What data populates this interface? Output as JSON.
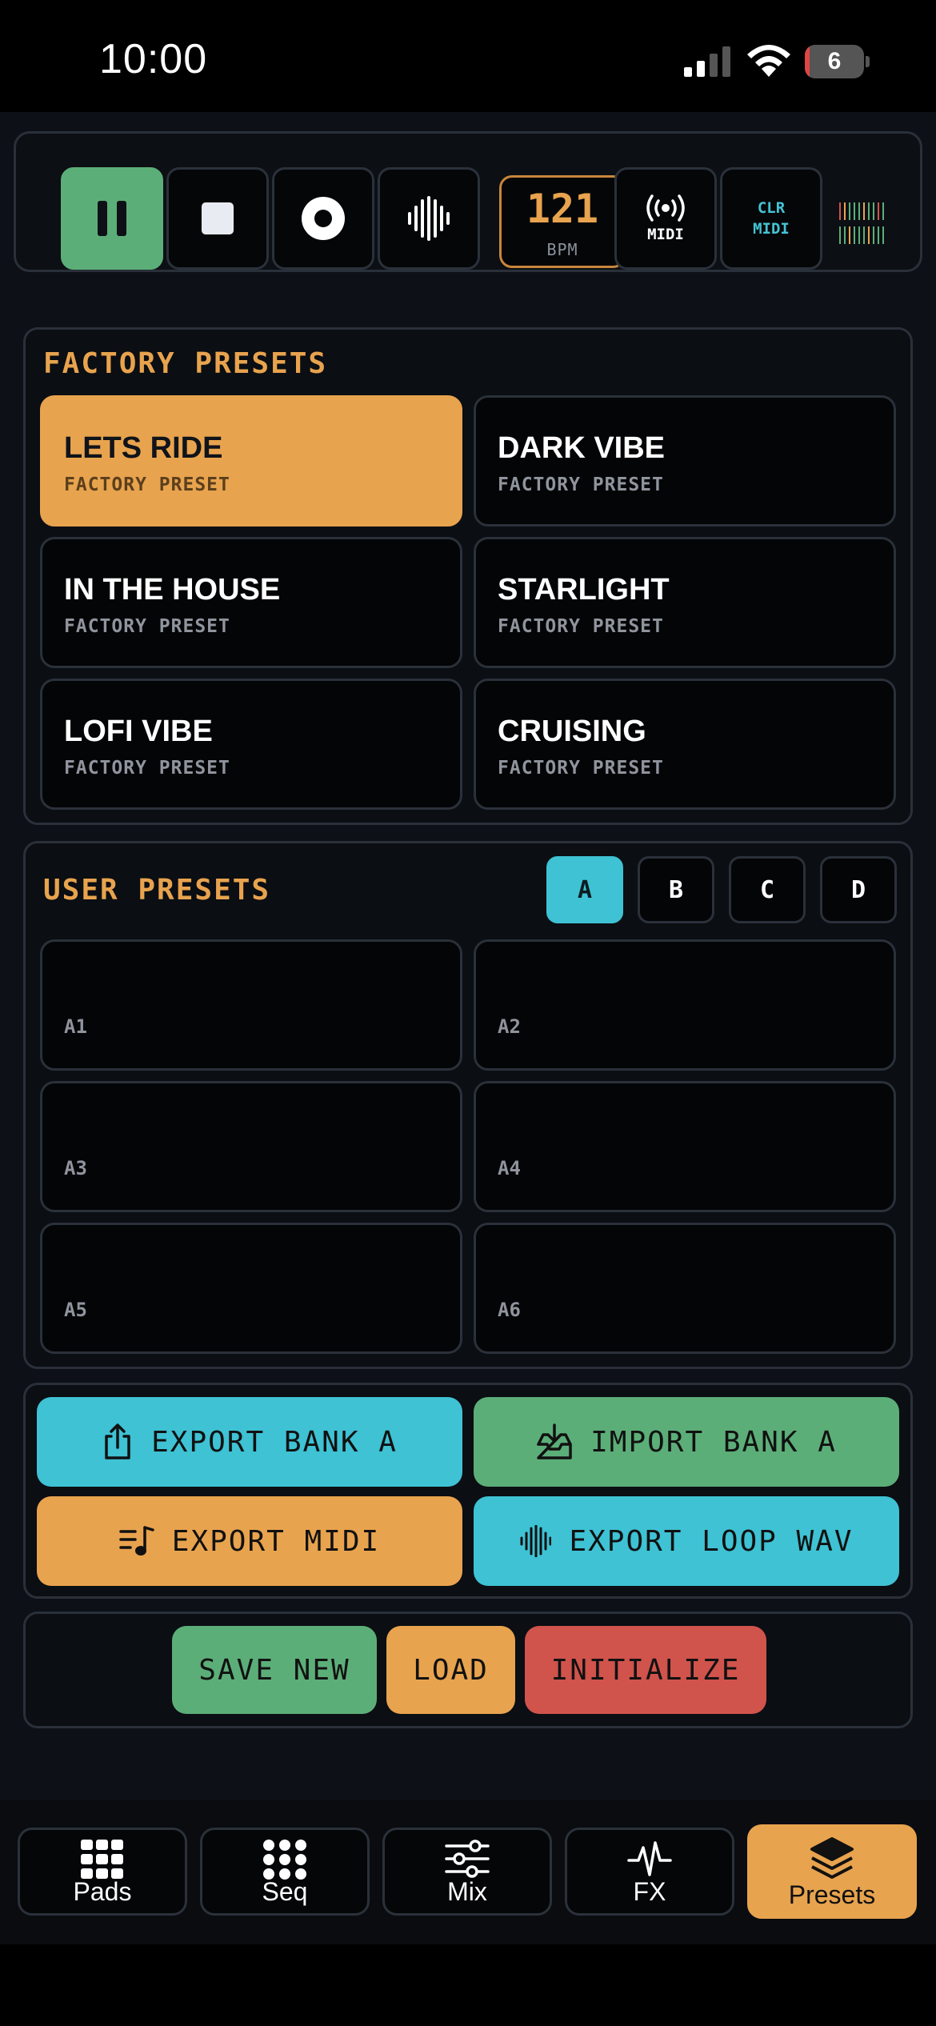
{
  "status": {
    "time": "10:00",
    "battery": "6",
    "battery_level": 0.06
  },
  "transport": {
    "bpm_value": "121",
    "bpm_label": "BPM",
    "midi_label": "MIDI",
    "clr_line1": "CLR",
    "clr_line2": "MIDI"
  },
  "factory": {
    "title": "FACTORY PRESETS",
    "presets": [
      {
        "name": "LETS RIDE",
        "sub": "FACTORY PRESET"
      },
      {
        "name": "DARK VIBE",
        "sub": "FACTORY PRESET"
      },
      {
        "name": "IN THE HOUSE",
        "sub": "FACTORY PRESET"
      },
      {
        "name": "STARLIGHT",
        "sub": "FACTORY PRESET"
      },
      {
        "name": "LOFI VIBE",
        "sub": "FACTORY PRESET"
      },
      {
        "name": "CRUISING",
        "sub": "FACTORY PRESET"
      }
    ]
  },
  "user": {
    "title": "USER PRESETS",
    "banks": [
      "A",
      "B",
      "C",
      "D"
    ],
    "slots": [
      "A1",
      "A2",
      "A3",
      "A4",
      "A5",
      "A6"
    ]
  },
  "actions": {
    "export_bank": "EXPORT BANK A",
    "import_bank": "IMPORT BANK A",
    "export_midi": "EXPORT MIDI",
    "export_wav": "EXPORT LOOP WAV"
  },
  "footer": {
    "save_new": "SAVE NEW",
    "load": "LOAD",
    "initialize": "INITIALIZE"
  },
  "tabs": [
    {
      "label": "Pads",
      "icon": "grid-icon"
    },
    {
      "label": "Seq",
      "icon": "dots-grid-icon"
    },
    {
      "label": "Mix",
      "icon": "sliders-icon"
    },
    {
      "label": "FX",
      "icon": "pulse-icon"
    },
    {
      "label": "Presets",
      "icon": "layers-icon"
    }
  ],
  "colors": {
    "accent_orange": "#e8a34e",
    "accent_teal": "#3ec2d4",
    "accent_green": "#5cae78",
    "accent_red": "#d0534c"
  }
}
